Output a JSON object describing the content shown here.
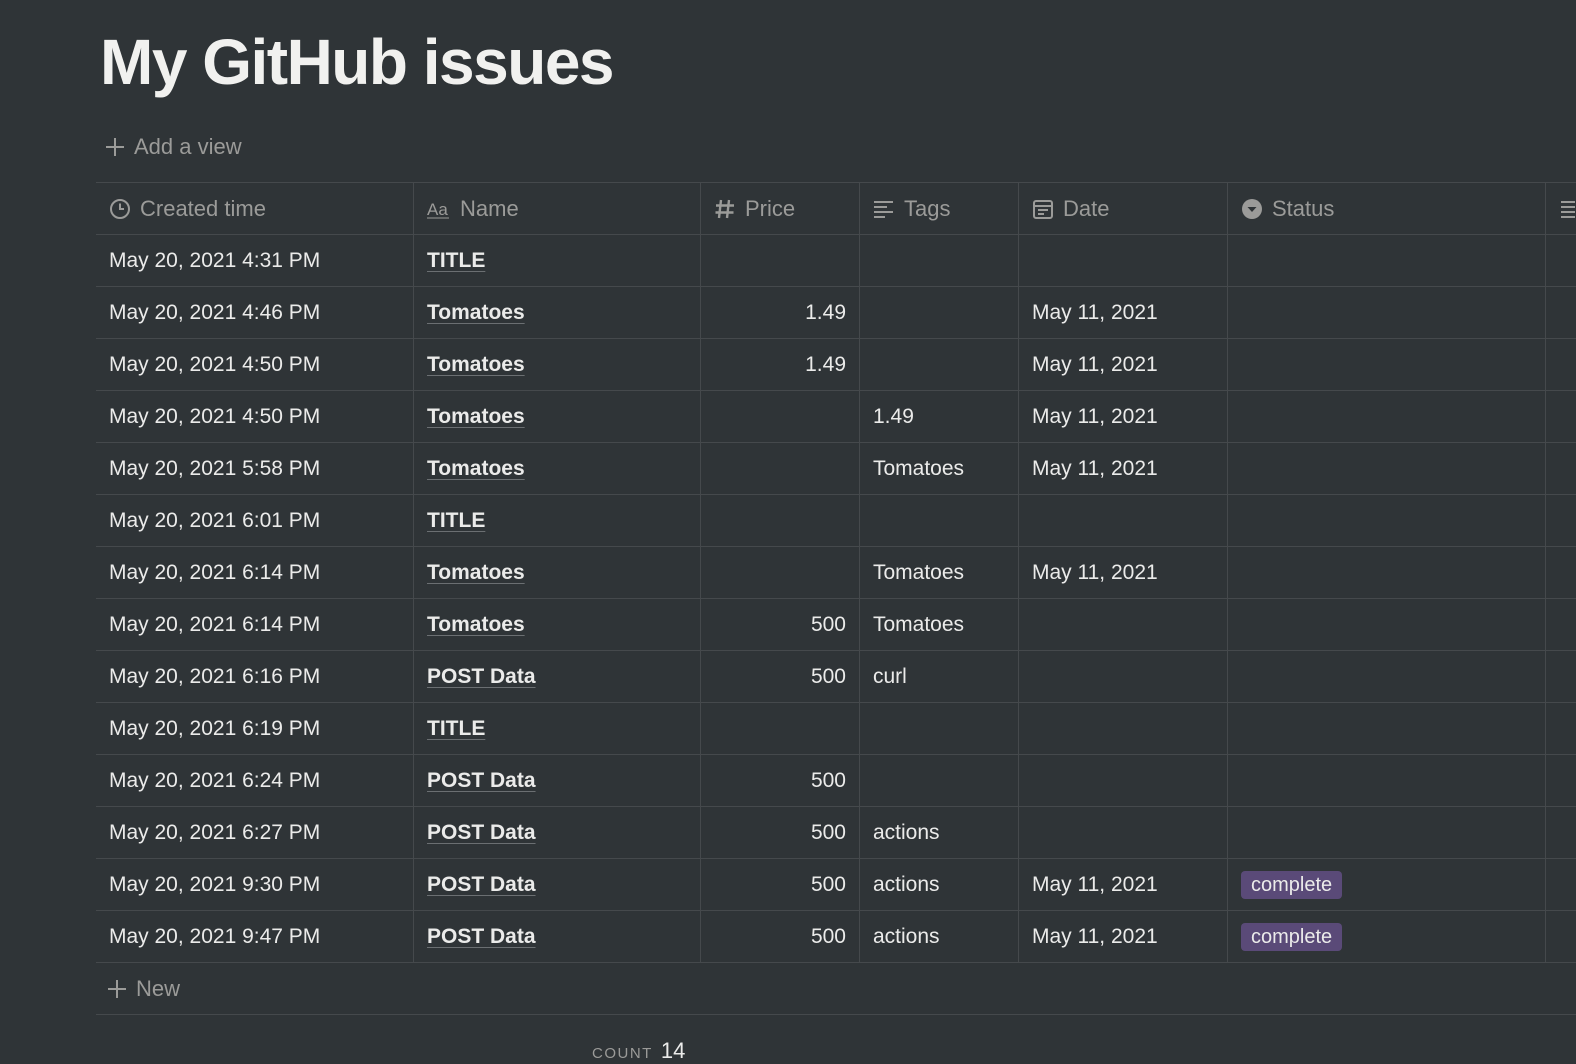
{
  "page": {
    "title": "My GitHub issues",
    "add_view_label": "Add a view"
  },
  "table": {
    "columns": [
      {
        "label": "Created time",
        "icon": "clock-icon"
      },
      {
        "label": "Name",
        "icon": "text-aa-icon"
      },
      {
        "label": "Price",
        "icon": "hash-icon"
      },
      {
        "label": "Tags",
        "icon": "lines-icon"
      },
      {
        "label": "Date",
        "icon": "calendar-icon"
      },
      {
        "label": "Status",
        "icon": "status-icon"
      }
    ],
    "rows": [
      {
        "created": "May 20, 2021 4:31 PM",
        "name": "TITLE",
        "price": "",
        "tags": "",
        "date": "",
        "status": ""
      },
      {
        "created": "May 20, 2021 4:46 PM",
        "name": "Tomatoes",
        "price": "1.49",
        "tags": "",
        "date": "May 11, 2021",
        "status": ""
      },
      {
        "created": "May 20, 2021 4:50 PM",
        "name": "Tomatoes",
        "price": "1.49",
        "tags": "",
        "date": "May 11, 2021",
        "status": ""
      },
      {
        "created": "May 20, 2021 4:50 PM",
        "name": "Tomatoes",
        "price": "",
        "tags": "1.49",
        "date": "May 11, 2021",
        "status": ""
      },
      {
        "created": "May 20, 2021 5:58 PM",
        "name": "Tomatoes",
        "price": "",
        "tags": "Tomatoes",
        "date": "May 11, 2021",
        "status": ""
      },
      {
        "created": "May 20, 2021 6:01 PM",
        "name": "TITLE",
        "price": "",
        "tags": "",
        "date": "",
        "status": ""
      },
      {
        "created": "May 20, 2021 6:14 PM",
        "name": "Tomatoes",
        "price": "",
        "tags": "Tomatoes",
        "date": "May 11, 2021",
        "status": ""
      },
      {
        "created": "May 20, 2021 6:14 PM",
        "name": "Tomatoes",
        "price": "500",
        "tags": "Tomatoes",
        "date": "",
        "status": ""
      },
      {
        "created": "May 20, 2021 6:16 PM",
        "name": "POST Data",
        "price": "500",
        "tags": "curl",
        "date": "",
        "status": ""
      },
      {
        "created": "May 20, 2021 6:19 PM",
        "name": "TITLE",
        "price": "",
        "tags": "",
        "date": "",
        "status": ""
      },
      {
        "created": "May 20, 2021 6:24 PM",
        "name": "POST Data",
        "price": "500",
        "tags": "",
        "date": "",
        "status": ""
      },
      {
        "created": "May 20, 2021 6:27 PM",
        "name": "POST Data",
        "price": "500",
        "tags": "actions",
        "date": "",
        "status": ""
      },
      {
        "created": "May 20, 2021 9:30 PM",
        "name": "POST Data",
        "price": "500",
        "tags": "actions",
        "date": "May 11, 2021",
        "status": "complete"
      },
      {
        "created": "May 20, 2021 9:47 PM",
        "name": "POST Data",
        "price": "500",
        "tags": "actions",
        "date": "May 11, 2021",
        "status": "complete"
      }
    ],
    "new_label": "New",
    "count_label": "COUNT",
    "count_value": "14"
  },
  "colors": {
    "background": "#2f3437",
    "status_complete": "#5a4a78",
    "muted_text": "#9b9b99"
  }
}
